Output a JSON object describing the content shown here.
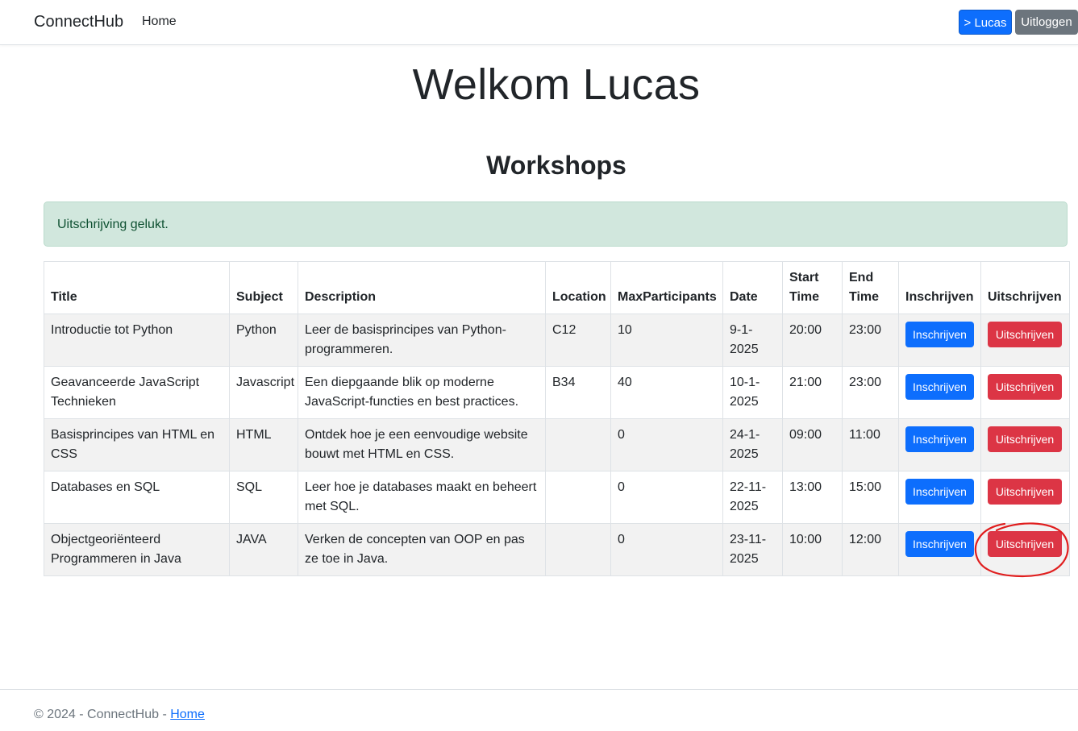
{
  "nav": {
    "brand": "ConnectHub",
    "home": "Home",
    "user_button": "> Lucas",
    "logout_button": "Uitloggen"
  },
  "welcome": "Welkom Lucas",
  "section_title": "Workshops",
  "alert": "Uitschrijving gelukt.",
  "table": {
    "headers": [
      "Title",
      "Subject",
      "Description",
      "Location",
      "MaxParticipants",
      "Date",
      "Start Time",
      "End Time",
      "Inschrijven",
      "Uitschrijven"
    ],
    "subscribe_label": "Inschrijven",
    "unsubscribe_label": "Uitschrijven",
    "rows": [
      {
        "title": "Introductie tot Python",
        "subject": "Python",
        "description": "Leer de basisprincipes van Python-programmeren.",
        "location": "C12",
        "max": "10",
        "date": "9-1-2025",
        "start": "20:00",
        "end": "23:00"
      },
      {
        "title": "Geavanceerde JavaScript Technieken",
        "subject": "Javascript",
        "description": "Een diepgaande blik op moderne JavaScript-functies en best practices.",
        "location": "B34",
        "max": "40",
        "date": "10-1-2025",
        "start": "21:00",
        "end": "23:00"
      },
      {
        "title": "Basisprincipes van HTML en CSS",
        "subject": "HTML",
        "description": "Ontdek hoe je een eenvoudige website bouwt met HTML en CSS.",
        "location": "",
        "max": "0",
        "date": "24-1-2025",
        "start": "09:00",
        "end": "11:00"
      },
      {
        "title": "Databases en SQL",
        "subject": "SQL",
        "description": "Leer hoe je databases maakt en beheert met SQL.",
        "location": "",
        "max": "0",
        "date": "22-11-2025",
        "start": "13:00",
        "end": "15:00"
      },
      {
        "title": "Objectgeoriënteerd Programmeren in Java",
        "subject": "JAVA",
        "description": "Verken de concepten van OOP en pas ze toe in Java.",
        "location": "",
        "max": "0",
        "date": "23-11-2025",
        "start": "10:00",
        "end": "12:00"
      }
    ]
  },
  "footer": {
    "text": "© 2024 - ConnectHub - ",
    "link": "Home"
  },
  "colors": {
    "primary": "#0d6efd",
    "danger": "#dc3545",
    "secondary": "#6c757d",
    "success_bg": "#d1e7dd",
    "success_text": "#0f5132",
    "annotation": "#e01e1e"
  }
}
